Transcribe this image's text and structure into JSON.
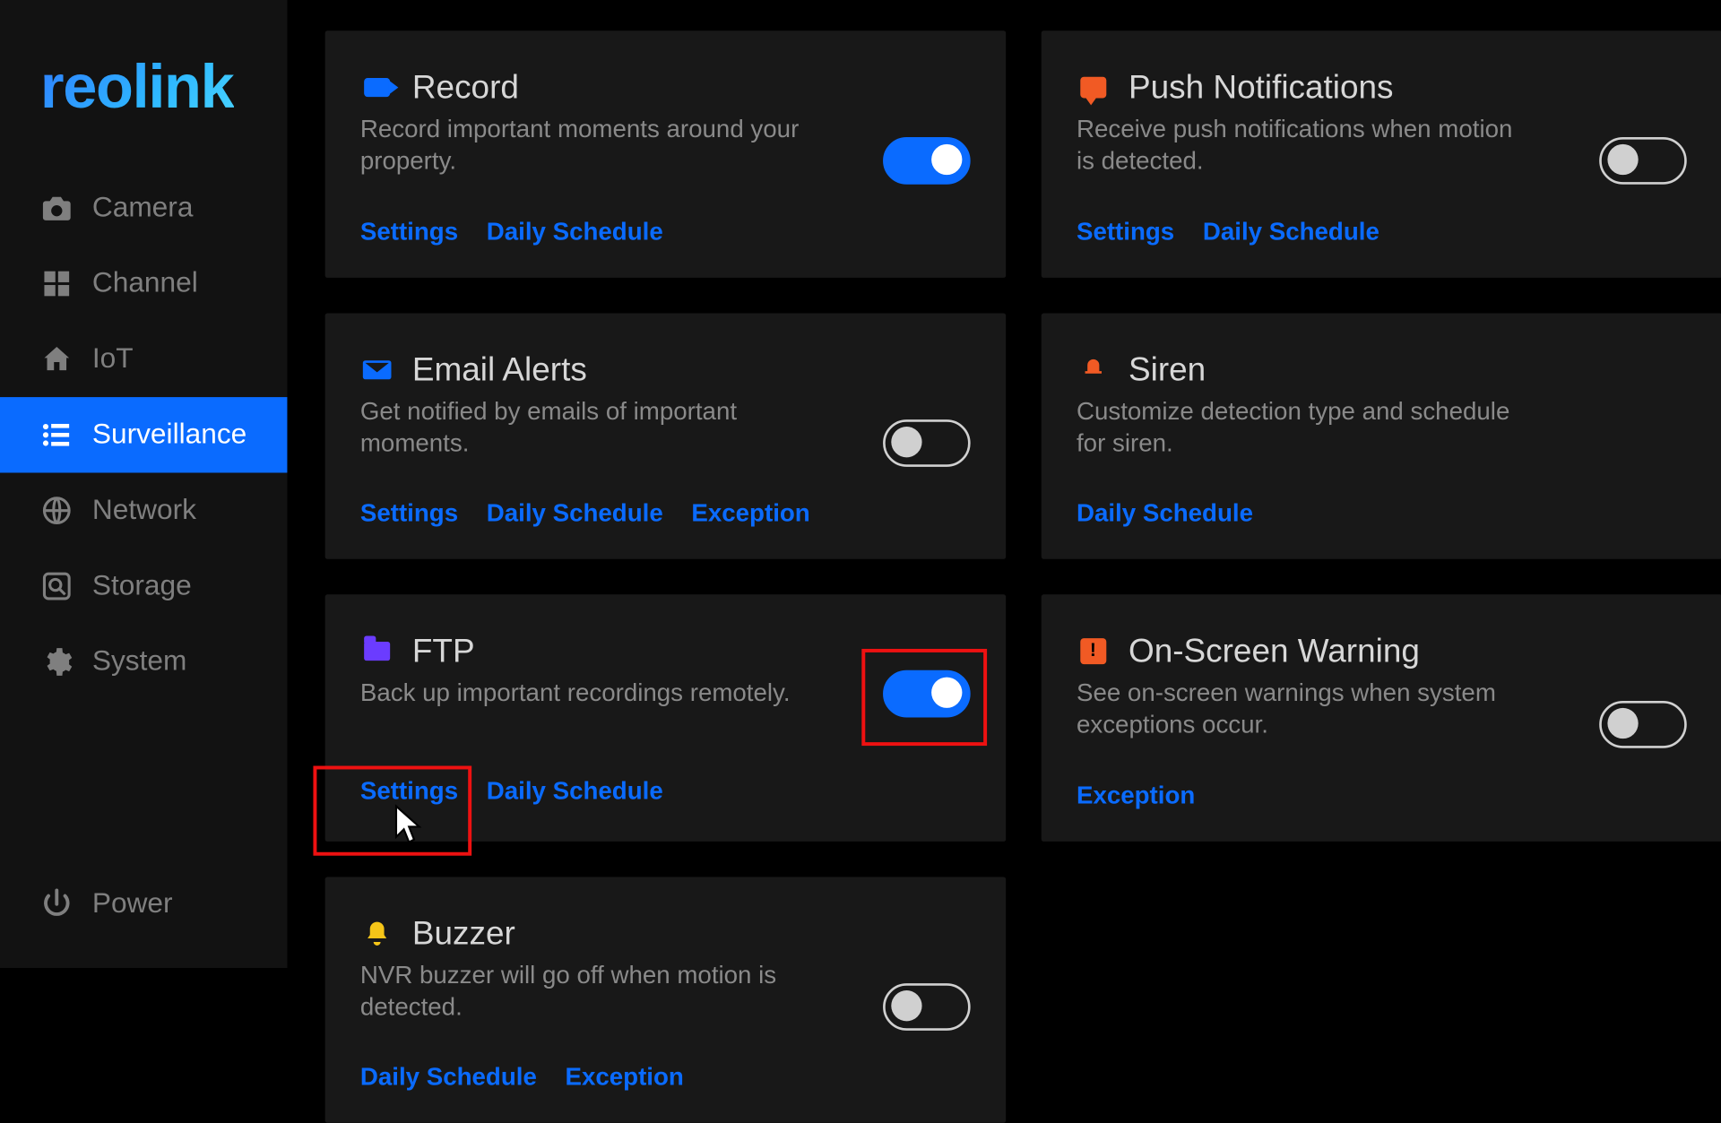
{
  "brand": "reolink",
  "sidebar": {
    "items": [
      {
        "label": "Camera"
      },
      {
        "label": "Channel"
      },
      {
        "label": "IoT"
      },
      {
        "label": "Surveillance"
      },
      {
        "label": "Network"
      },
      {
        "label": "Storage"
      },
      {
        "label": "System"
      }
    ],
    "power": "Power"
  },
  "links": {
    "settings": "Settings",
    "daily": "Daily Schedule",
    "exception": "Exception"
  },
  "cards": {
    "record": {
      "title": "Record",
      "desc": "Record important moments around your property."
    },
    "push": {
      "title": "Push Notifications",
      "desc": "Receive push notifications when motion is detected."
    },
    "email": {
      "title": "Email Alerts",
      "desc": "Get notified by emails of important moments."
    },
    "siren": {
      "title": "Siren",
      "desc": "Customize detection type and schedule for siren."
    },
    "ftp": {
      "title": "FTP",
      "desc": "Back up important recordings remotely."
    },
    "osw": {
      "title": "On-Screen Warning",
      "desc": "See on-screen warnings when system exceptions occur."
    },
    "buzzer": {
      "title": "Buzzer",
      "desc": "NVR buzzer will go off when motion is detected."
    }
  }
}
